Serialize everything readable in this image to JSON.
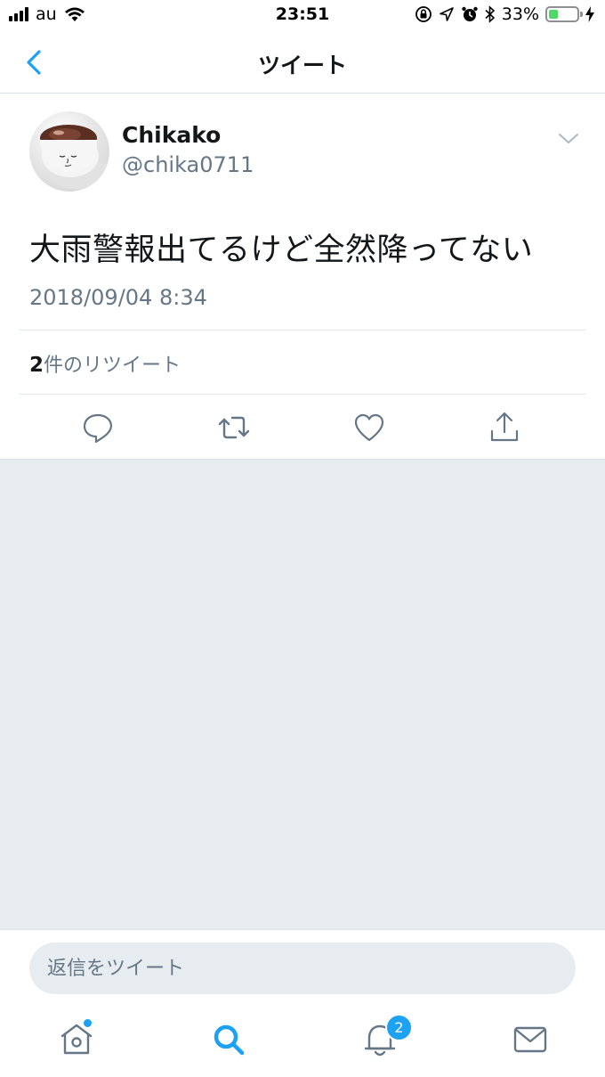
{
  "status_bar": {
    "carrier": "au",
    "time": "23:51",
    "battery_percent": "33%",
    "battery_level": 0.33,
    "icons": [
      "signal-bars-icon",
      "wifi-icon",
      "orientation-lock-icon",
      "location-arrow-icon",
      "alarm-icon",
      "bluetooth-icon",
      "battery-icon",
      "charging-bolt-icon"
    ]
  },
  "nav": {
    "title": "ツイート",
    "back_icon": "chevron-left-icon"
  },
  "tweet": {
    "display_name": "Chikako",
    "handle": "@chika0711",
    "text": "大雨警報出てるけど全然降ってない",
    "timestamp": "2018/09/04 8:34",
    "retweet_number": "2",
    "retweet_label": "件のリツイート",
    "menu_icon": "chevron-down-icon"
  },
  "actions": [
    {
      "name": "reply",
      "icon": "reply-bubble-icon"
    },
    {
      "name": "retweet",
      "icon": "retweet-icon"
    },
    {
      "name": "like",
      "icon": "heart-icon"
    },
    {
      "name": "share",
      "icon": "share-icon"
    }
  ],
  "reply": {
    "placeholder": "返信をツイート"
  },
  "tabs": [
    {
      "name": "home",
      "icon": "home-icon",
      "has_dot": true
    },
    {
      "name": "search",
      "icon": "search-icon",
      "active": true
    },
    {
      "name": "notifications",
      "icon": "bell-icon",
      "badge": "2"
    },
    {
      "name": "messages",
      "icon": "envelope-icon"
    }
  ],
  "colors": {
    "accent": "#1da1f2",
    "secondary_text": "#657786",
    "background_gray": "#e6ecf0",
    "battery_green": "#4cd964"
  }
}
